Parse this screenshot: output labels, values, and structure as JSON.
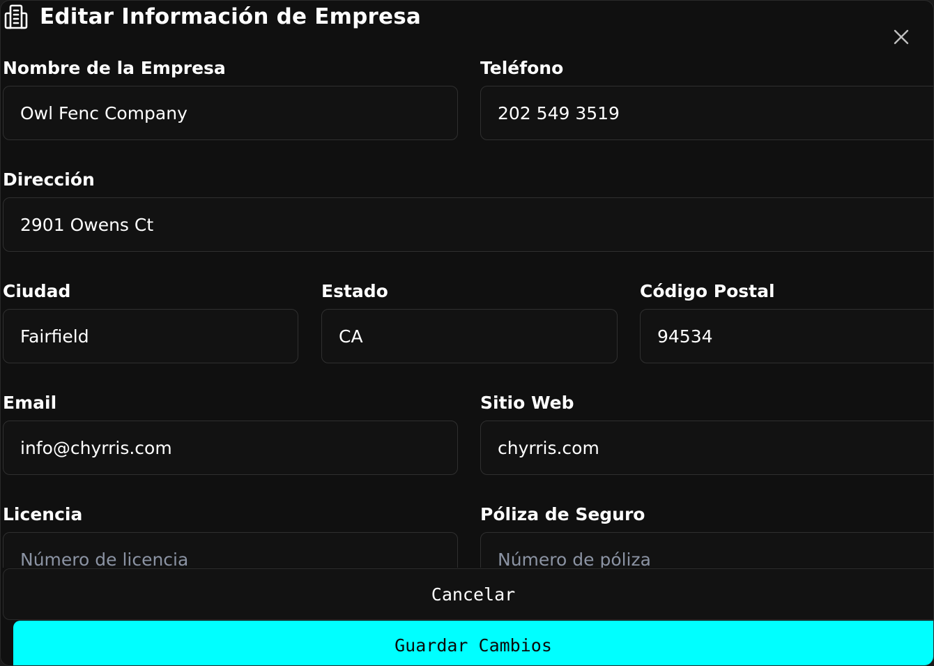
{
  "dialog": {
    "title": "Editar Información de Empresa",
    "icon": "building-document-icon",
    "close_icon": "close-icon"
  },
  "fields": {
    "company_name": {
      "label": "Nombre de la Empresa",
      "value": "Owl Fenc Company"
    },
    "phone": {
      "label": "Teléfono",
      "value": "202 549 3519"
    },
    "address": {
      "label": "Dirección",
      "value": "2901 Owens Ct"
    },
    "city": {
      "label": "Ciudad",
      "value": "Fairfield"
    },
    "state": {
      "label": "Estado",
      "value": "CA"
    },
    "zip": {
      "label": "Código Postal",
      "value": "94534"
    },
    "email": {
      "label": "Email",
      "value": "info@chyrris.com"
    },
    "website": {
      "label": "Sitio Web",
      "value": "chyrris.com"
    },
    "license": {
      "label": "Licencia",
      "value": "",
      "placeholder": "Número de licencia"
    },
    "insurance": {
      "label": "Póliza de Seguro",
      "value": "",
      "placeholder": "Número de póliza"
    }
  },
  "actions": {
    "cancel_label": "Cancelar",
    "save_label": "Guardar Cambios"
  },
  "colors": {
    "accent": "#00ffff",
    "background": "#101010",
    "input_border": "#303030",
    "placeholder": "#8b93a3"
  }
}
